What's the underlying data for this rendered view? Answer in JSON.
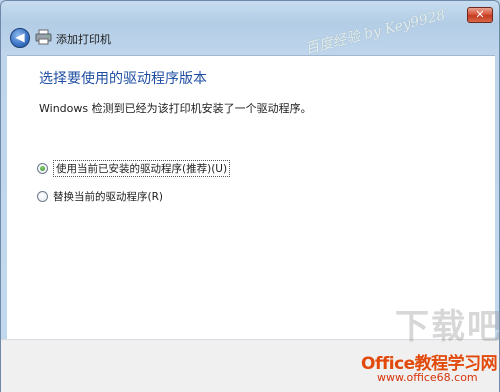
{
  "window": {
    "title": "添加打印机",
    "close_symbol": "✕",
    "back_symbol": "◀"
  },
  "content": {
    "heading": "选择要使用的驱动程序版本",
    "description": "Windows 检测到已经为该打印机安装了一个驱动程序。",
    "options": [
      {
        "label": "使用当前已安装的驱动程序(推荐)(U)",
        "checked": true
      },
      {
        "label": "替换当前的驱动程序(R)",
        "checked": false
      }
    ]
  },
  "watermarks": {
    "top_right": "百度经验 by Key9928",
    "logo_text": "Office教程学习网",
    "logo_url": "www.office68.com",
    "logo_big": "下载吧"
  },
  "colors": {
    "heading": "#1f4fa3",
    "close_button": "#c43a1f",
    "logo": "#e24a0b"
  },
  "icons": [
    "back-arrow-icon",
    "printer-icon",
    "close-icon"
  ]
}
